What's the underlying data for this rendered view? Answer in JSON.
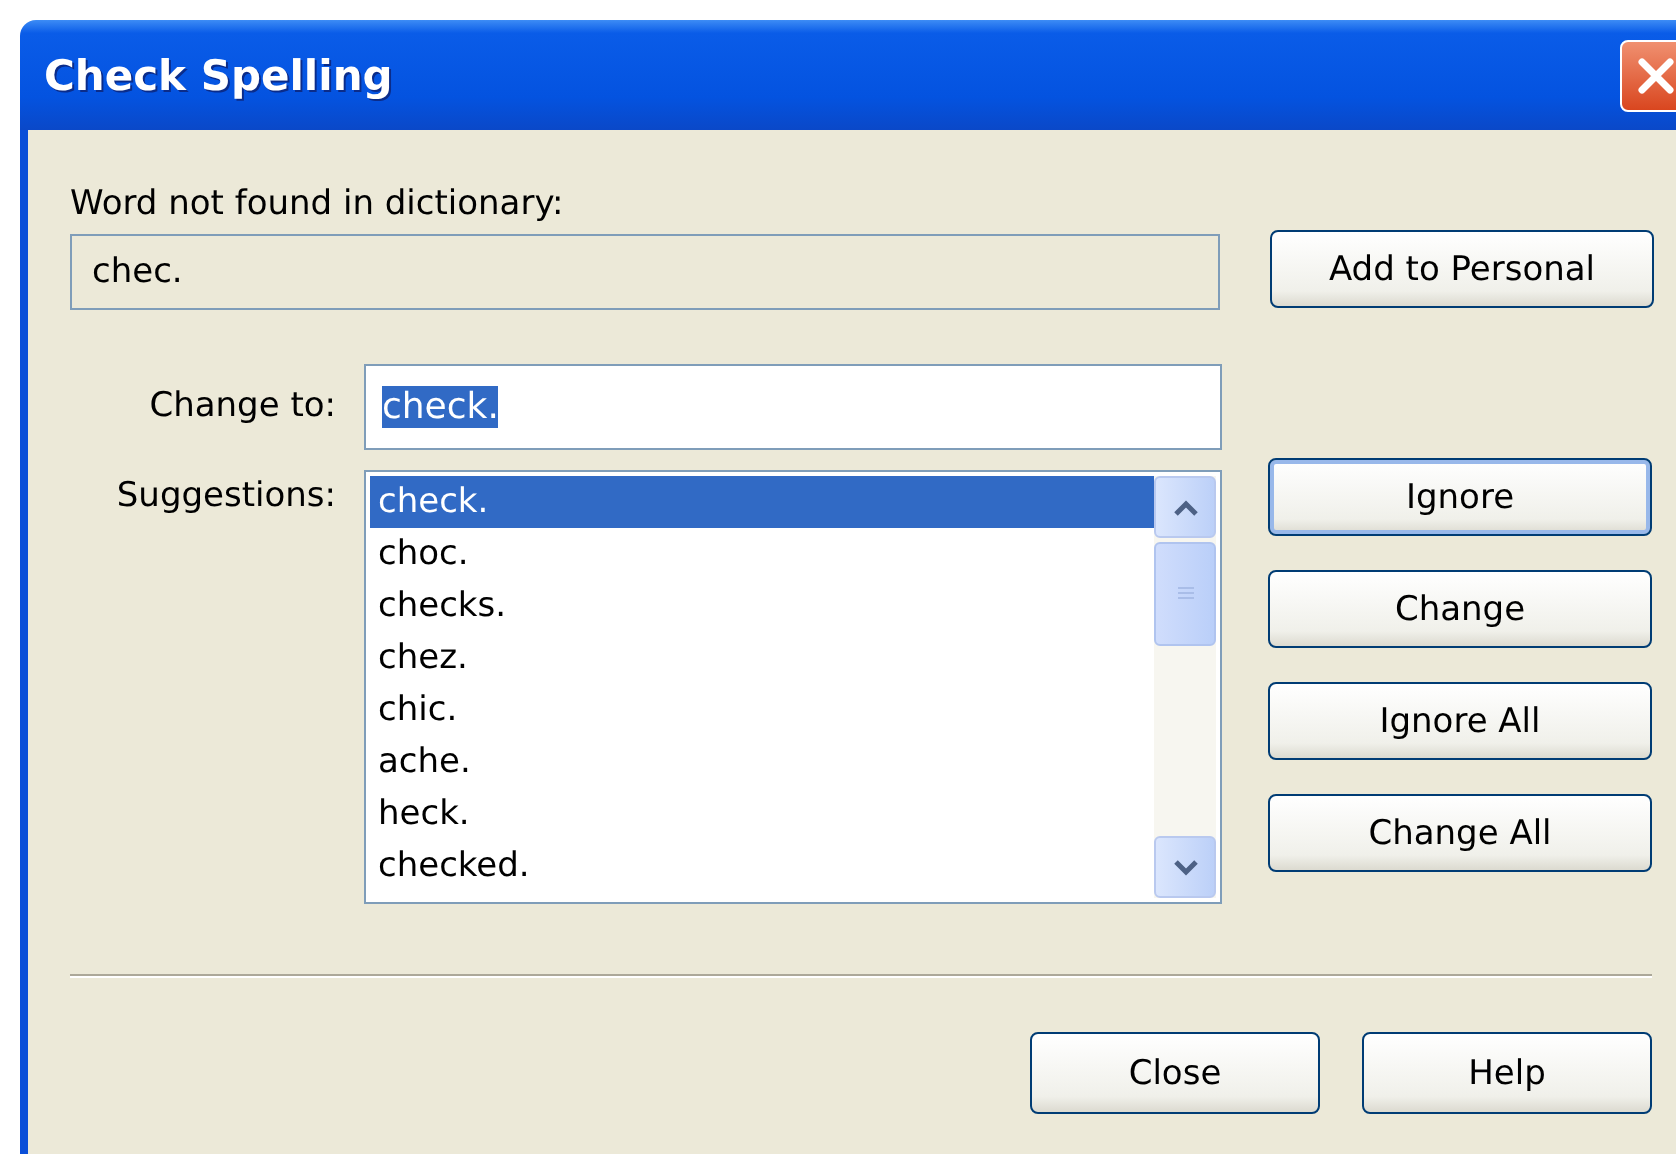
{
  "window": {
    "title": "Check Spelling"
  },
  "word_not_found": {
    "label": "Word not found in dictionary:",
    "value": "chec."
  },
  "change_to": {
    "label": "Change to:",
    "value": "check.",
    "text_selected": true
  },
  "suggestions": {
    "label": "Suggestions:",
    "items": [
      {
        "text": "check.",
        "selected": true
      },
      {
        "text": "choc.",
        "selected": false
      },
      {
        "text": "checks.",
        "selected": false
      },
      {
        "text": "chez.",
        "selected": false
      },
      {
        "text": "chic.",
        "selected": false
      },
      {
        "text": "ache.",
        "selected": false
      },
      {
        "text": "heck.",
        "selected": false
      },
      {
        "text": "checked.",
        "selected": false
      }
    ]
  },
  "side_buttons": [
    {
      "label": "Add to Personal",
      "default": false
    },
    {
      "label": "Ignore",
      "default": true
    },
    {
      "label": "Change",
      "default": false
    },
    {
      "label": "Ignore All",
      "default": false
    },
    {
      "label": "Change All",
      "default": false
    }
  ],
  "bottom_buttons": [
    "Close",
    "Help"
  ]
}
